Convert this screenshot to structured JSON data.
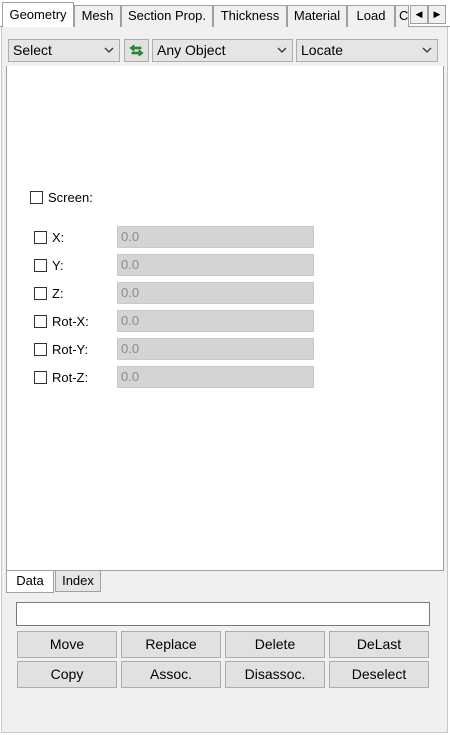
{
  "tabs": [
    {
      "label": "Geometry",
      "active": true
    },
    {
      "label": "Mesh"
    },
    {
      "label": "Section Prop."
    },
    {
      "label": "Thickness"
    },
    {
      "label": "Material"
    },
    {
      "label": "Load"
    },
    {
      "label": "C"
    }
  ],
  "toolbar": {
    "mode_select": "Select",
    "object_select": "Any Object",
    "action_select": "Locate"
  },
  "screen": {
    "label": "Screen:"
  },
  "coords": [
    {
      "label": "X:",
      "value": "0.0"
    },
    {
      "label": "Y:",
      "value": "0.0"
    },
    {
      "label": "Z:",
      "value": "0.0"
    },
    {
      "label": "Rot-X:",
      "value": "0.0"
    },
    {
      "label": "Rot-Y:",
      "value": "0.0"
    },
    {
      "label": "Rot-Z:",
      "value": "0.0"
    }
  ],
  "bottom_tabs": [
    {
      "label": "Data",
      "active": true
    },
    {
      "label": "Index"
    }
  ],
  "input": {
    "value": ""
  },
  "buttons": {
    "move": "Move",
    "replace": "Replace",
    "delete": "Delete",
    "delast": "DeLast",
    "copy": "Copy",
    "assoc": "Assoc.",
    "disassoc": "Disassoc.",
    "deselect": "Deselect"
  },
  "colors": {
    "disabled_field": "#d4d4d4",
    "swap_icon": "#1f9d2e"
  }
}
